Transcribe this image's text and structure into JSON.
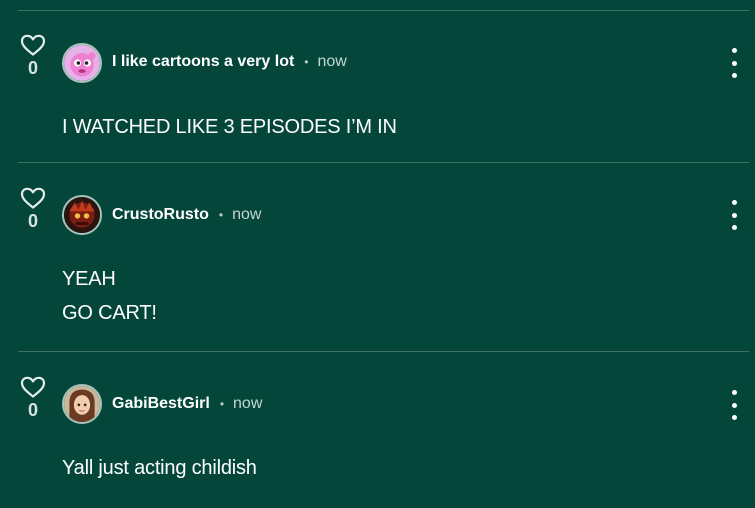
{
  "comments": [
    {
      "likes": "0",
      "username": "I like cartoons a very lot",
      "separator": "•",
      "time": "now",
      "lines": [
        "I WATCHED LIKE 3 EPISODES I’M IN"
      ],
      "avatar": "pink-cartoon-character-avatar"
    },
    {
      "likes": "0",
      "username": "CrustoRusto",
      "separator": "•",
      "time": "now",
      "lines": [
        "YEAH",
        "GO CART!"
      ],
      "avatar": "dark-red-character-avatar"
    },
    {
      "likes": "0",
      "username": "GabiBestGirl",
      "separator": "•",
      "time": "now",
      "lines": [
        "Yall just acting childish"
      ],
      "avatar": "anime-girl-avatar"
    }
  ],
  "colors": {
    "background": "#04473A",
    "divider": "#3f7167",
    "text": "#ffffff",
    "muted": "#c3d6d0"
  }
}
